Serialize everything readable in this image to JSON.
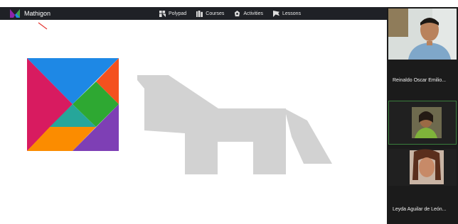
{
  "app": {
    "brand": "Mathigon"
  },
  "nav": [
    {
      "label": "Polypad",
      "icon": "polypad-icon"
    },
    {
      "label": "Courses",
      "icon": "courses-icon"
    },
    {
      "label": "Activities",
      "icon": "activities-icon"
    },
    {
      "label": "Lessons",
      "icon": "lessons-icon"
    }
  ],
  "participants": [
    {
      "name": "Reinaldo Oscar Emilio..."
    },
    {
      "name": ""
    },
    {
      "name": ""
    },
    {
      "name": "Leyda Aguilar de León..."
    }
  ],
  "colors": {
    "topbar": "#1f2126",
    "tangram_blue": "#1e88e5",
    "tangram_red": "#f4511e",
    "tangram_green": "#2ea832",
    "tangram_teal": "#26a69a",
    "tangram_magenta": "#d81b60",
    "tangram_orange": "#fb8c00",
    "tangram_purple": "#7e3fb5",
    "silhouette": "#d2d2d2",
    "active_border": "#3a7d3d"
  }
}
